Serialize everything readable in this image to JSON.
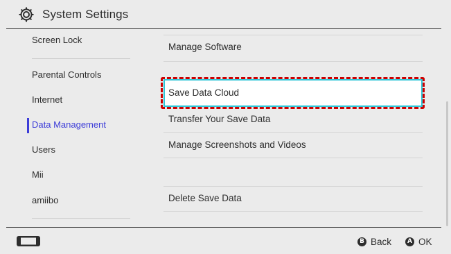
{
  "header": {
    "title": "System Settings",
    "icon": "gear-icon"
  },
  "sidebar": {
    "items": [
      {
        "label": "Screen Lock"
      },
      {
        "label": "Parental Controls"
      },
      {
        "label": "Internet"
      },
      {
        "label": "Data Management",
        "active": true
      },
      {
        "label": "Users"
      },
      {
        "label": "Mii"
      },
      {
        "label": "amiibo"
      }
    ]
  },
  "main": {
    "rows": [
      {
        "label": "Manage Software"
      },
      {
        "label": "Save Data Cloud",
        "selected": true
      },
      {
        "label": "Transfer Your Save Data"
      },
      {
        "label": "Manage Screenshots and Videos"
      },
      {
        "label": "Delete Save Data"
      }
    ]
  },
  "footer": {
    "back": {
      "glyph": "B",
      "label": "Back"
    },
    "ok": {
      "glyph": "A",
      "label": "OK"
    }
  },
  "colors": {
    "background": "#ebebeb",
    "accent": "#3c3cd8",
    "selection_border": "#2ec6d8",
    "annotation_red": "#cc0000"
  }
}
